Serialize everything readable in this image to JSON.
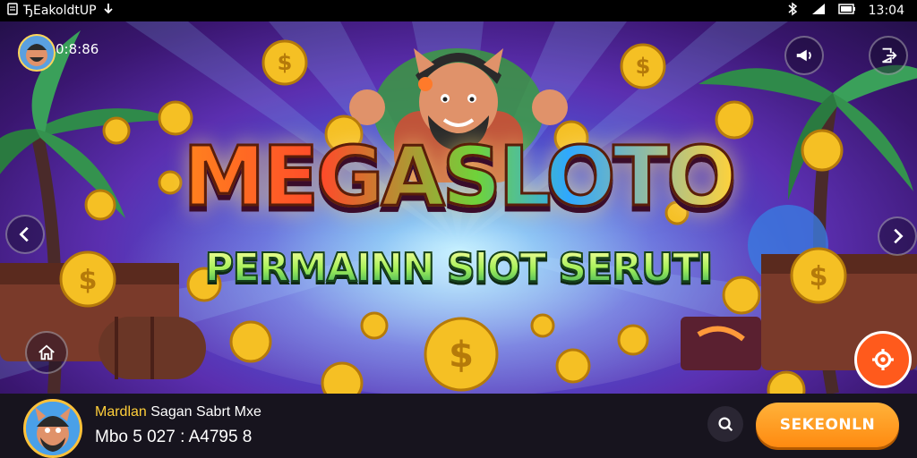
{
  "status_bar": {
    "notification_text": "ЂEakoldtUP",
    "time": "13:04",
    "icons": [
      "notification-icon",
      "download-icon",
      "bluetooth-icon",
      "signal-icon",
      "battery-icon"
    ]
  },
  "game": {
    "title": "MEGASLOTO",
    "subtitle": "PERMAINN SlOT SERUTI",
    "coin_balance": "0:8:86",
    "top_right_buttons": [
      "megaphone-icon",
      "exit-icon"
    ],
    "nav": {
      "left": "chevron-left-icon",
      "right": "chevron-right-icon"
    },
    "home_icon": "home-icon",
    "settings_icon": "gear-icon"
  },
  "bottom_bar": {
    "highlight_name": "Mardlan",
    "line1_rest": " Sagan Sabrt Mxe",
    "line2": "Mbo 5 027  : A47̈95 8",
    "cta_label": "SEKEONLN",
    "search_icon": "search-icon"
  },
  "colors": {
    "accent_orange": "#ff8a10",
    "settings_red": "#ff5a1c",
    "bar_bg": "#17141e",
    "highlight_yellow": "#ffcf3a"
  }
}
